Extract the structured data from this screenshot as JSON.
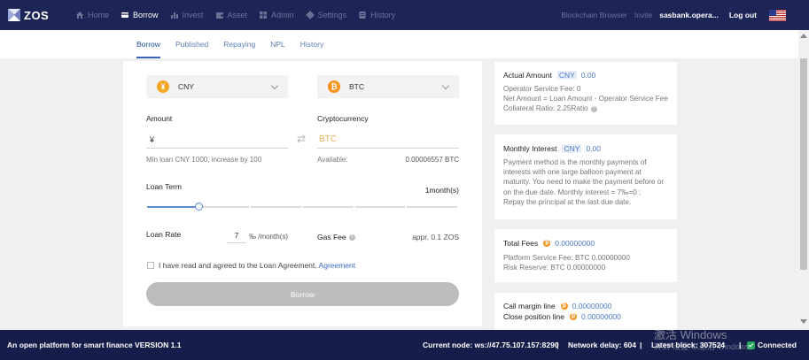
{
  "brand": {
    "name": "ZOS"
  },
  "nav": {
    "items": [
      {
        "label": "Home",
        "icon": "home-icon"
      },
      {
        "label": "Borrow",
        "icon": "borrow-icon",
        "active": true
      },
      {
        "label": "Invest",
        "icon": "chart-icon"
      },
      {
        "label": "Asset",
        "icon": "wallet-icon"
      },
      {
        "label": "Admin",
        "icon": "grid-icon"
      },
      {
        "label": "Settings",
        "icon": "gear-icon"
      },
      {
        "label": "History",
        "icon": "history-icon"
      }
    ],
    "blockchain_browser": "Blockchain Browser",
    "invite": "Invite",
    "user": "sasbank.opera...",
    "logout": "Log out",
    "flag": "us-flag-icon"
  },
  "subtabs": [
    "Borrow",
    "Published",
    "Repaying",
    "NPL",
    "History"
  ],
  "form": {
    "fiat_select": "CNY",
    "fiat_symbol": "¥",
    "crypto_select": "BTC",
    "crypto_symbol": "₿",
    "amount_label": "Amount",
    "amount_prefix": "¥",
    "amount_value": "",
    "crypto_label": "Cryptocurrency",
    "crypto_placeholder": "BTC",
    "min_loan_hint": "Min loan CNY 1000, increase by 100",
    "available_label": "Available:",
    "available_value": "0.00006557 BTC",
    "loan_term_label": "Loan Term",
    "loan_term_value": "1month(s)",
    "loan_term_progress": 0.165,
    "loan_rate_label": "Loan Rate",
    "loan_rate_value": "7",
    "loan_rate_unit": "‰ /month(s)",
    "gas_fee_label": "Gas Fee",
    "gas_fee_value": "appr. 0.1 ZOS",
    "agreement_text": "I have read and agreed to the Loan Agreement.",
    "agreement_link": "Agreement",
    "borrow_button": "Borrow"
  },
  "cards": {
    "actual_amount": {
      "title": "Actual Amount",
      "unit": "CNY",
      "value": "0.00",
      "lines": [
        "Operator Service Fee: 0",
        "Net Amount = Loan Amount - Operator Service Fee",
        "Collateral Ratio: 2.25Ratio"
      ]
    },
    "monthly_interest": {
      "title": "Monthly Interest",
      "unit": "CNY",
      "value": "0.00",
      "lines": [
        "Payment method is the monthly payments of",
        "interests with one large balloon payment at",
        "maturity. You need to make the payment before or",
        "on the due date. Monthly interest = 7‰=0 ;",
        "Repay the principal at the last due date."
      ]
    },
    "total_fees": {
      "title": "Total Fees",
      "value": "0.00000000",
      "lines": [
        "Platform Service Fee: BTC 0.00000000",
        "Risk Reserve: BTC 0.00000000"
      ]
    },
    "margin": {
      "call_label": "Call margin line",
      "call_value": "0.00000000",
      "close_label": "Close position line",
      "close_value": "0.00000000"
    }
  },
  "footer": {
    "platform": "An open platform for smart finance VERSION 1.1",
    "node": "Current node: ws://47.75.107.157:8290",
    "sep": "|",
    "delay": "Network delay: 604",
    "block": "Latest block: 307524",
    "connected": "Connected",
    "watermark_1": "激活 Windows",
    "watermark_2": "转到“设置”以激活 Windows。"
  }
}
